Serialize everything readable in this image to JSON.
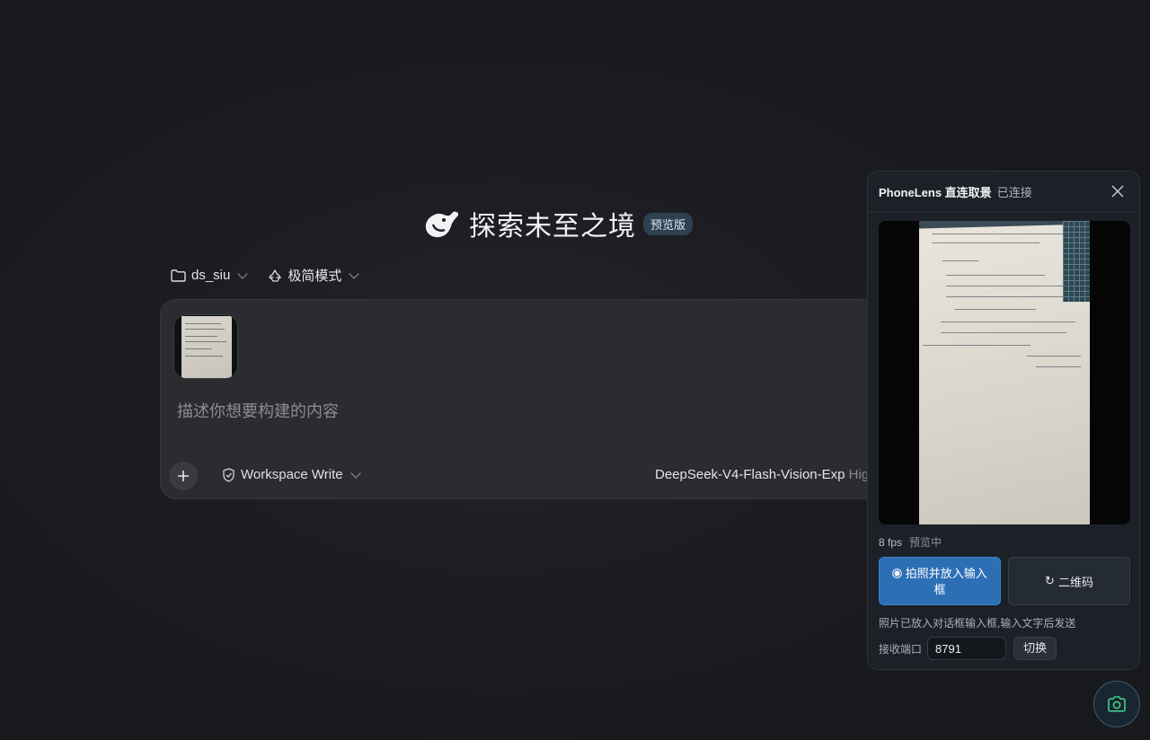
{
  "hero": {
    "title": "探索未至之境",
    "badge": "预览版"
  },
  "toolbar": {
    "folder": "ds_siu",
    "mode": "极简模式"
  },
  "composer": {
    "placeholder": "描述你想要构建的内容",
    "permission": "Workspace Write",
    "model": "DeepSeek-V4-Flash-Vision-Exp",
    "effort": "Hig"
  },
  "panel": {
    "title": "PhoneLens 直连取景",
    "status": "已连接",
    "fps": "8 fps",
    "preview_status": "预览中",
    "capture_label": "拍照并放入输入框",
    "qr_label": "二维码",
    "note": "照片已放入对话框输入框,输入文字后发送",
    "port_label": "接收端口",
    "port_value": "8791",
    "switch_label": "切换"
  },
  "colors": {
    "accent": "#2d6fb5",
    "fab_icon": "#3ecf8e",
    "background": "#1d1e23"
  },
  "icons": [
    "whale-logo-icon",
    "folder-icon",
    "recycle-icon",
    "chevron-down-icon",
    "plus-icon",
    "shield-icon",
    "close-icon",
    "radio-icon",
    "refresh-icon",
    "camera-icon"
  ]
}
